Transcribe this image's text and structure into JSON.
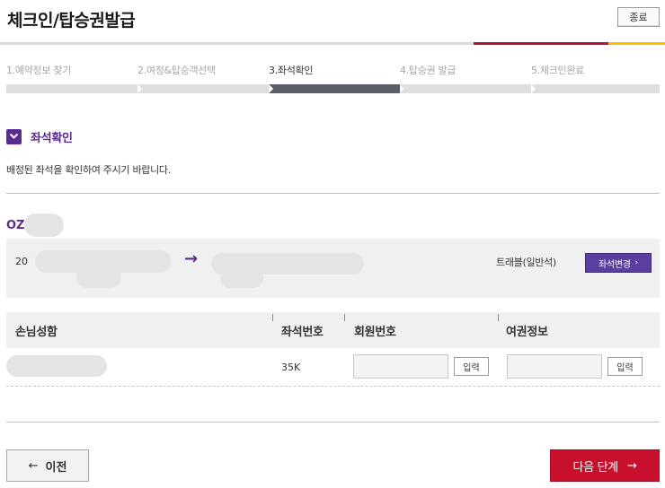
{
  "header": {
    "title": "체크인/탑승권발급",
    "close_label": "종료"
  },
  "steps": [
    {
      "label": "1.예약정보 찾기",
      "active": false
    },
    {
      "label": "2.여정&탑승객선택",
      "active": false
    },
    {
      "label": "3.좌석확인",
      "active": true
    },
    {
      "label": "4.탑승권 발급",
      "active": false
    },
    {
      "label": "5.체크인완료",
      "active": false
    }
  ],
  "section": {
    "title": "좌석확인",
    "description": "배정된 좌석을 확인하여 주시기 바랍니다."
  },
  "flight": {
    "code": "OZ",
    "date": "20",
    "cabin": "트래블(일반석)",
    "seat_change_label": "좌석변경"
  },
  "table": {
    "headers": [
      "손님성함",
      "좌석번호",
      "회원번호",
      "여권정보"
    ],
    "row": {
      "seat": "35K",
      "member_input_label": "입력",
      "passport_input_label": "입력"
    }
  },
  "footer": {
    "prev_label": "이전",
    "next_label": "다음 단계"
  },
  "colors": {
    "brand_purple": "#5b2a8e",
    "brand_red": "#c8102e",
    "active_step": "#5a5e66"
  }
}
